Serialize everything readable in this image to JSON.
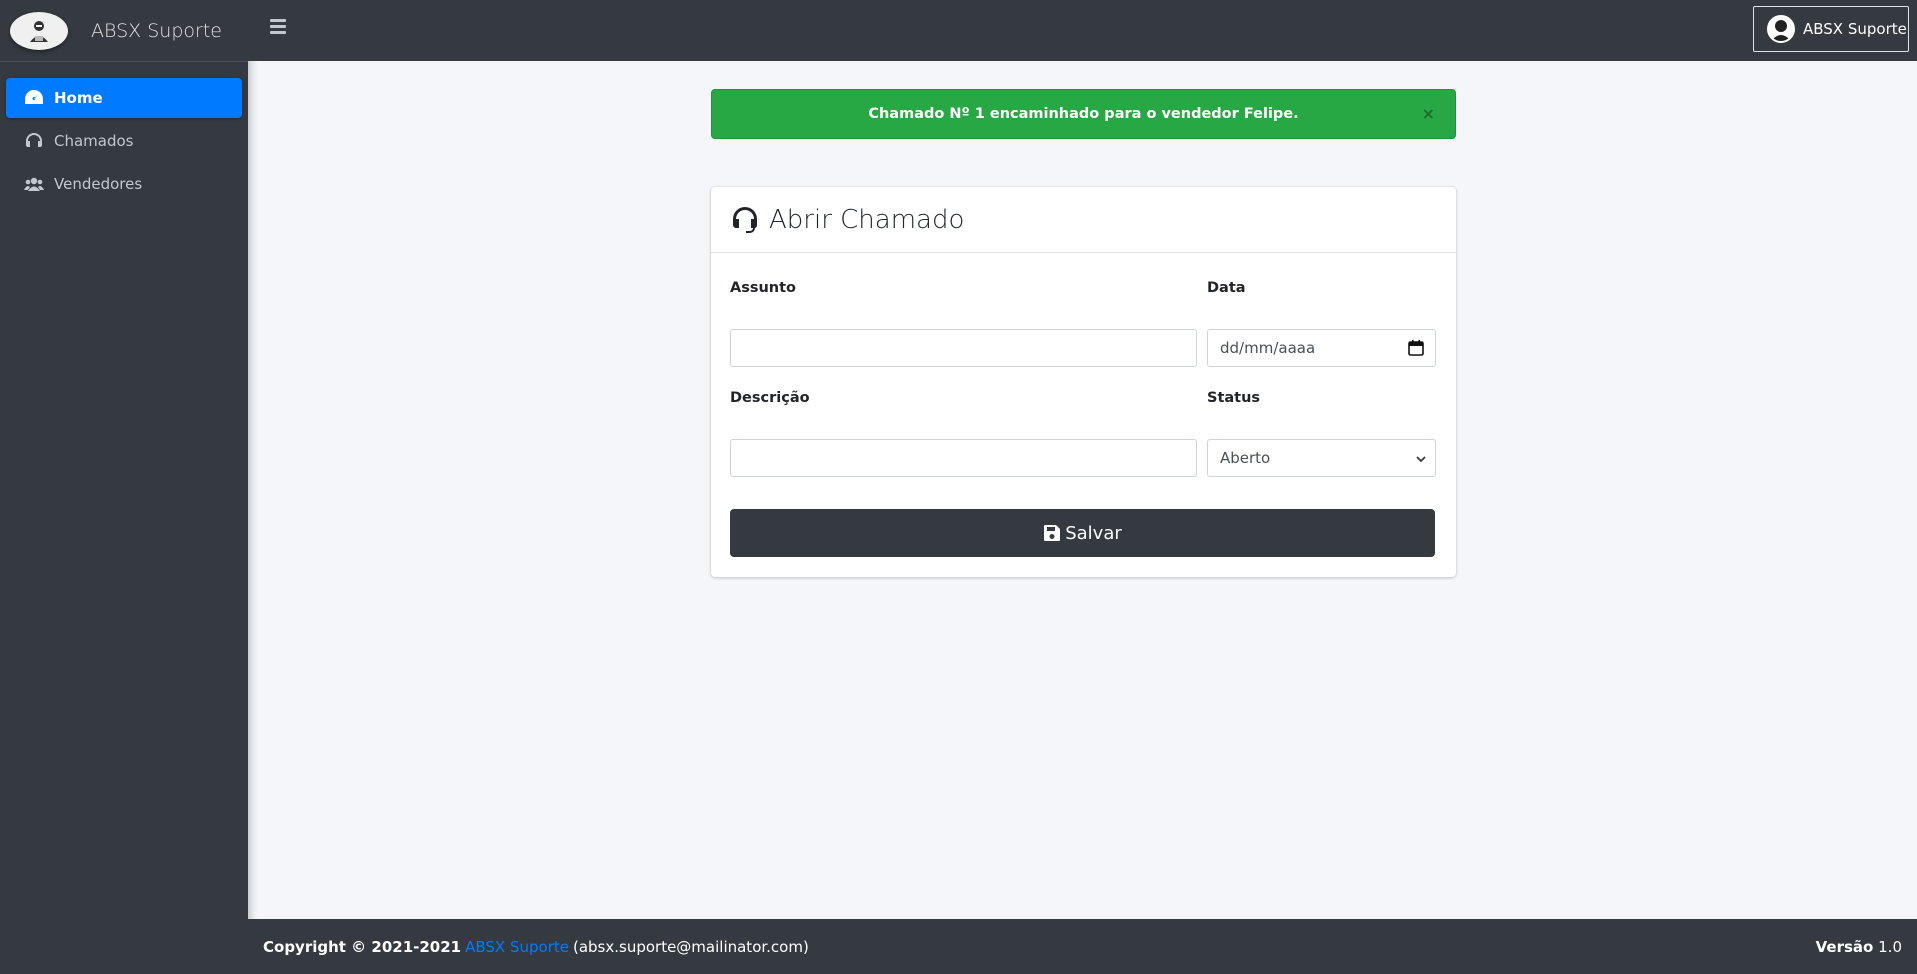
{
  "brand": {
    "name": "ABSX Suporte"
  },
  "sidebar": {
    "items": [
      {
        "label": "Home",
        "icon": "dashboard-icon",
        "active": true
      },
      {
        "label": "Chamados",
        "icon": "headset-icon",
        "active": false
      },
      {
        "label": "Vendedores",
        "icon": "users-icon",
        "active": false
      }
    ]
  },
  "topbar": {
    "user_label": "ABSX Suporte"
  },
  "alert": {
    "message": "Chamado Nº 1 encaminhado para o vendedor Felipe.",
    "close": "×"
  },
  "card": {
    "title": "Abrir Chamado",
    "fields": {
      "assunto_label": "Assunto",
      "assunto_value": "",
      "data_label": "Data",
      "data_placeholder": "dd/mm/aaaa",
      "descricao_label": "Descrição",
      "descricao_value": "",
      "status_label": "Status",
      "status_value": "Aberto"
    },
    "save_label": "Salvar"
  },
  "footer": {
    "copyright": "Copyright © 2021-2021",
    "link": "ABSX Suporte",
    "email": "(absx.suporte@mailinator.com)",
    "version_label": "Versão",
    "version_value": "1.0"
  },
  "colors": {
    "sidebar_bg": "#343a40",
    "accent": "#007bff",
    "alert_success": "#28a745",
    "content_bg": "#f4f6f9"
  }
}
